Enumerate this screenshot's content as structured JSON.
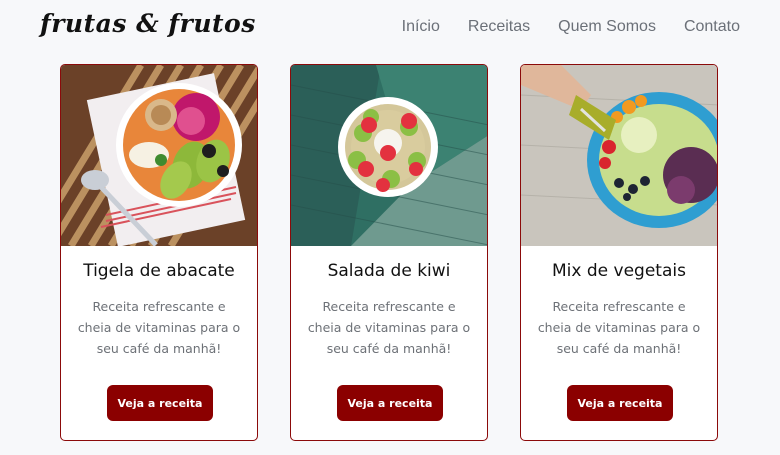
{
  "navbar": {
    "brand": "frutas & frutos",
    "links": [
      "Início",
      "Receitas",
      "Quem Somos",
      "Contato"
    ]
  },
  "cards": [
    {
      "title": "Tigela de abacate",
      "text": "Receita refrescante e cheia de vitaminas para o seu café da manhã!",
      "button": "Veja a receita"
    },
    {
      "title": "Salada de kiwi",
      "text": "Receita refrescante e cheia de vitaminas para o seu café da manhã!",
      "button": "Veja a receita"
    },
    {
      "title": "Mix de vegetais",
      "text": "Receita refrescante e cheia de vitaminas para o seu café da manhã!",
      "button": "Veja a receita"
    }
  ],
  "colors": {
    "accent": "#8b0000",
    "card_border": "#8b0a0a",
    "background": "#f7f8fa",
    "muted_text": "#6d7177"
  }
}
